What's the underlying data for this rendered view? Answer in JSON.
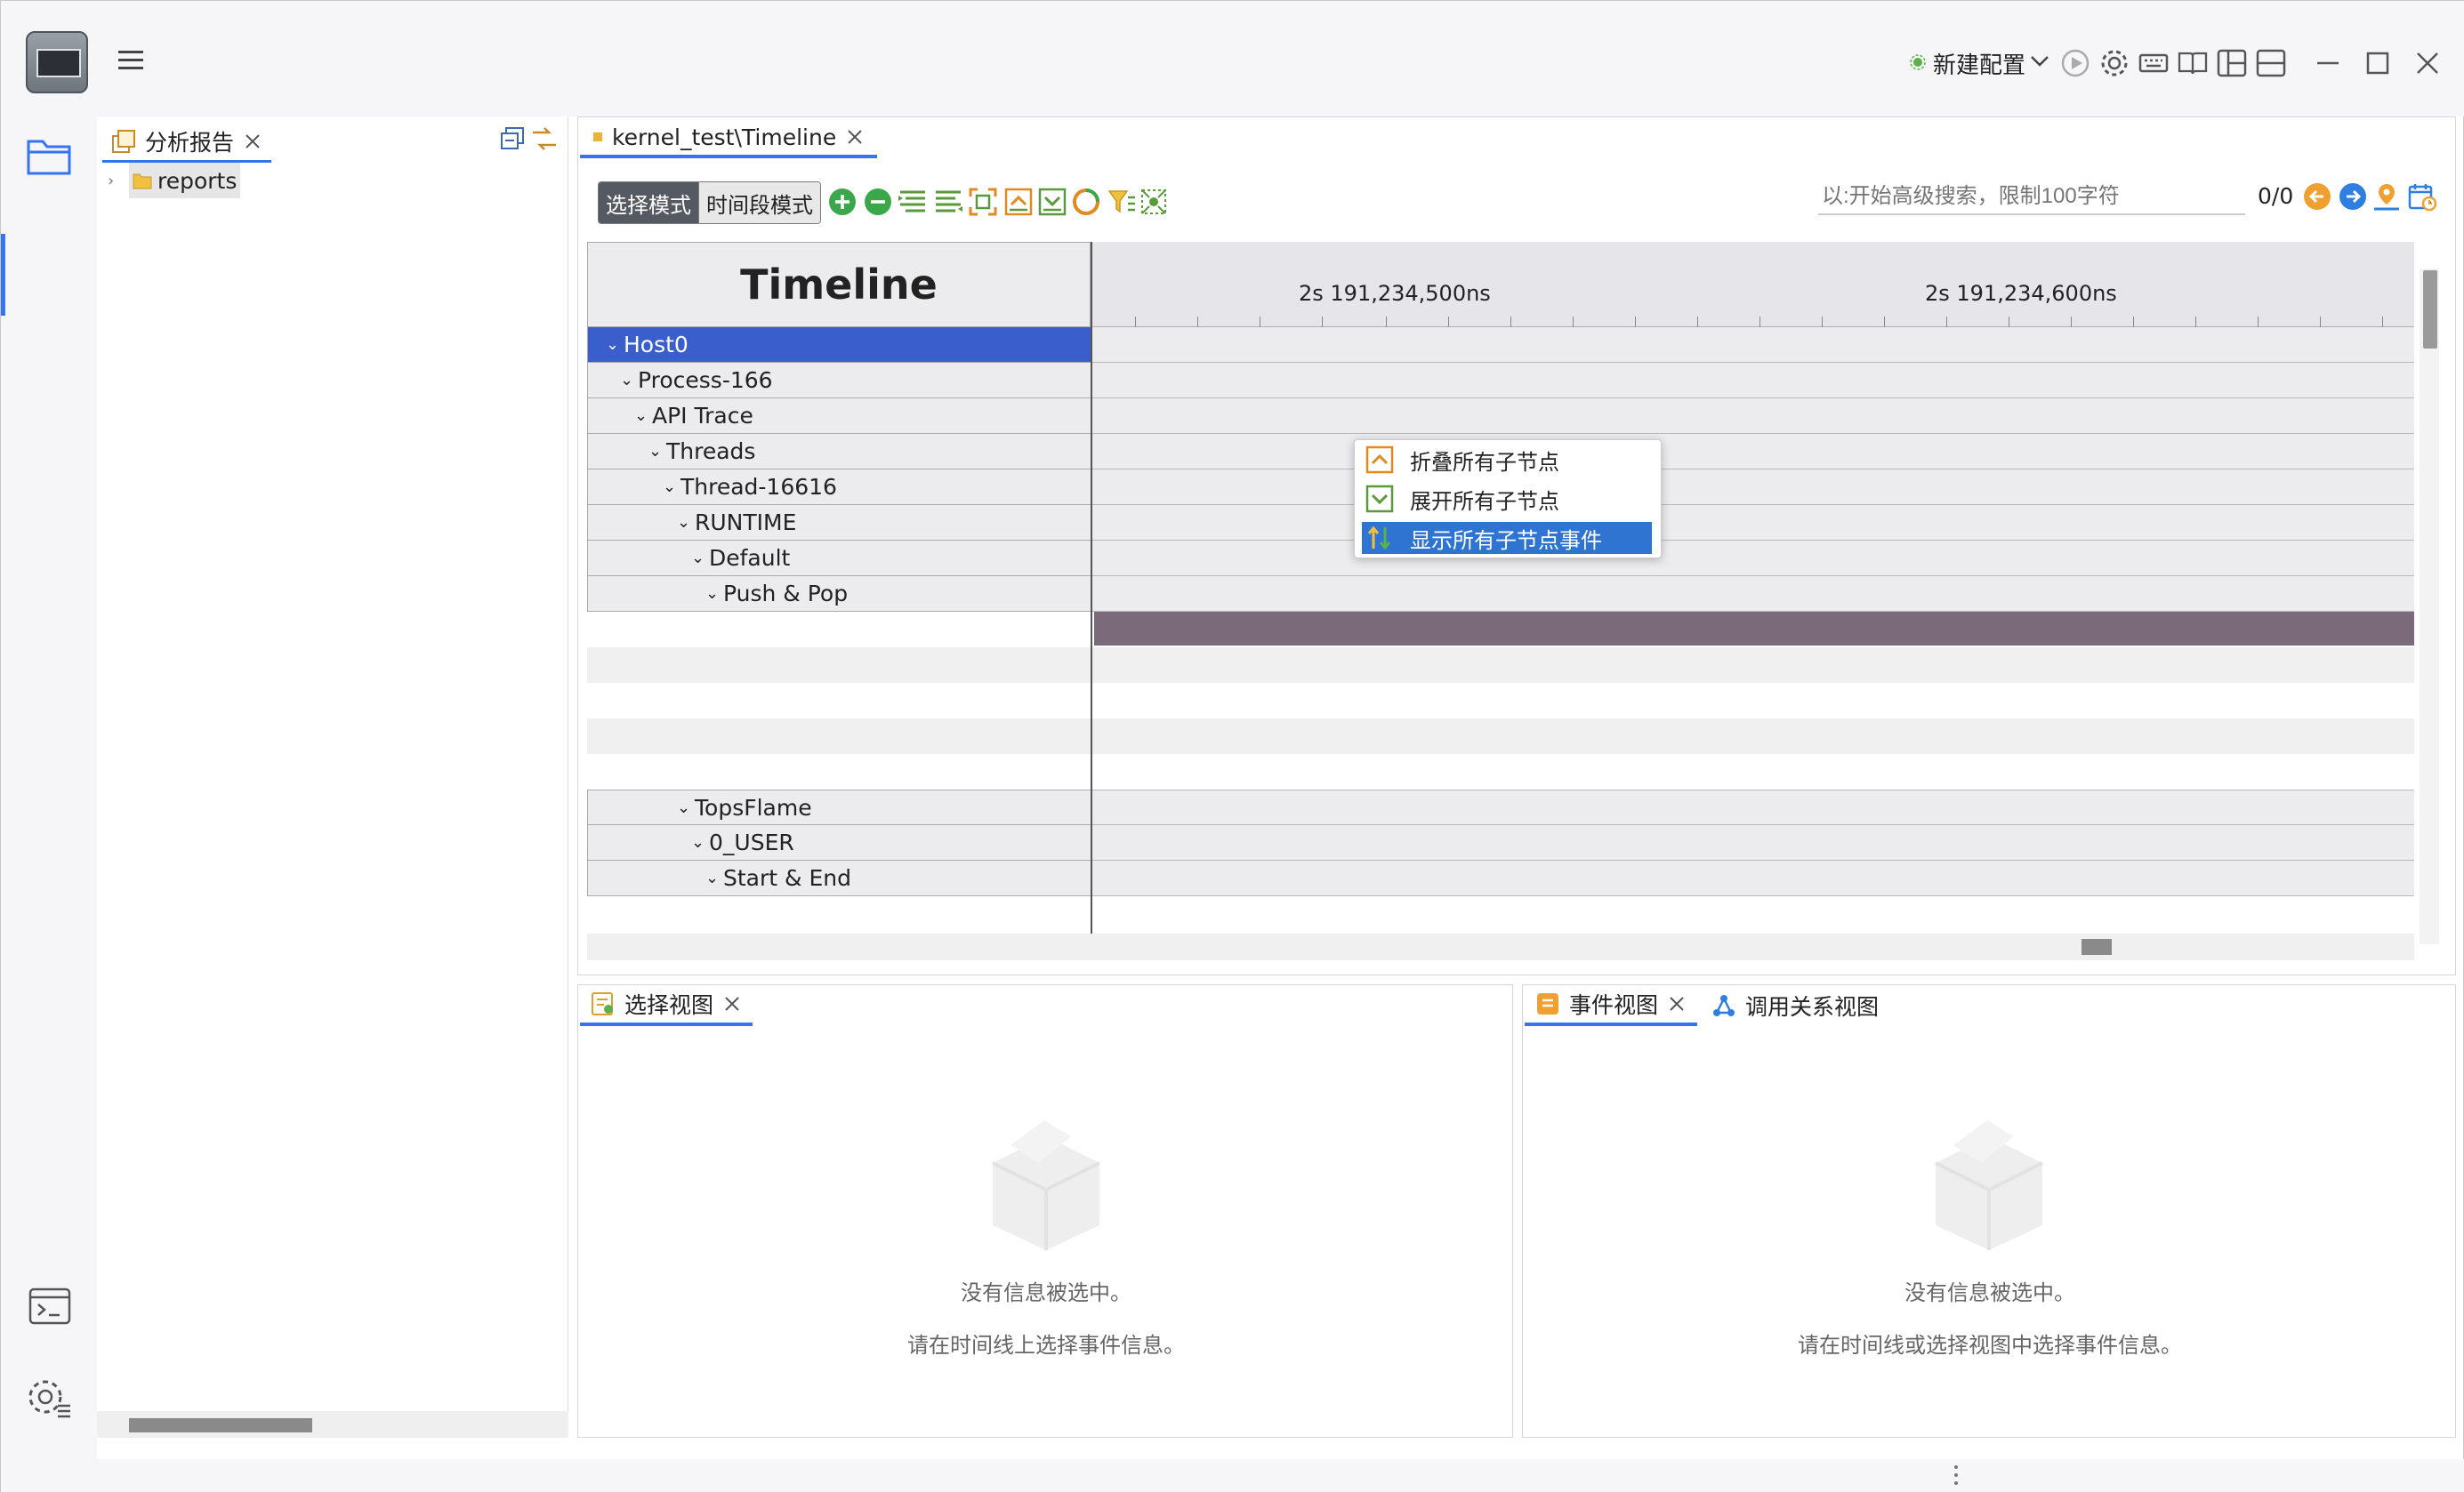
{
  "window": {
    "config_label": "新建配置",
    "controls": [
      "minimize-icon",
      "maximize-icon",
      "close-icon"
    ]
  },
  "left_panel": {
    "tab_label": "分析报告",
    "tree": [
      {
        "label": "reports"
      }
    ]
  },
  "editor": {
    "tab_label": "kernel_test\\Timeline",
    "mode_select": "选择模式",
    "mode_time": "时间段模式",
    "search_placeholder": "以:开始高级搜索，限制100字符",
    "search_count": "0/0",
    "timeline_title": "Timeline",
    "ruler_labels": [
      "2s 191,234,500ns",
      "2s 191,234,600ns"
    ],
    "rows": [
      {
        "label": "Host0",
        "selected": true
      },
      {
        "label": "Process-166"
      },
      {
        "label": "API Trace"
      },
      {
        "label": "Threads"
      },
      {
        "label": "Thread-16616"
      },
      {
        "label": "RUNTIME"
      },
      {
        "label": "Default"
      },
      {
        "label": "Push & Pop"
      },
      {
        "label": "TopsFlame"
      },
      {
        "label": "0_USER"
      },
      {
        "label": "Start & End"
      }
    ]
  },
  "context_menu": {
    "items": [
      {
        "label": "折叠所有子节点",
        "icon": "collapse-all-icon"
      },
      {
        "label": "展开所有子节点",
        "icon": "expand-all-icon"
      },
      {
        "label": "显示所有子节点事件",
        "icon": "show-events-icon",
        "highlighted": true
      }
    ]
  },
  "bottom_left": {
    "tab_label": "选择视图",
    "empty_line1": "没有信息被选中。",
    "empty_line2": "请在时间线上选择事件信息。"
  },
  "bottom_right": {
    "tab_event": "事件视图",
    "tab_call": "调用关系视图",
    "empty_line1": "没有信息被选中。",
    "empty_line2": "请在时间线或选择视图中选择事件信息。"
  },
  "colors": {
    "accent": "#3574f0",
    "selection": "#3a5fcd",
    "event_bar": "#7a6a7a"
  }
}
